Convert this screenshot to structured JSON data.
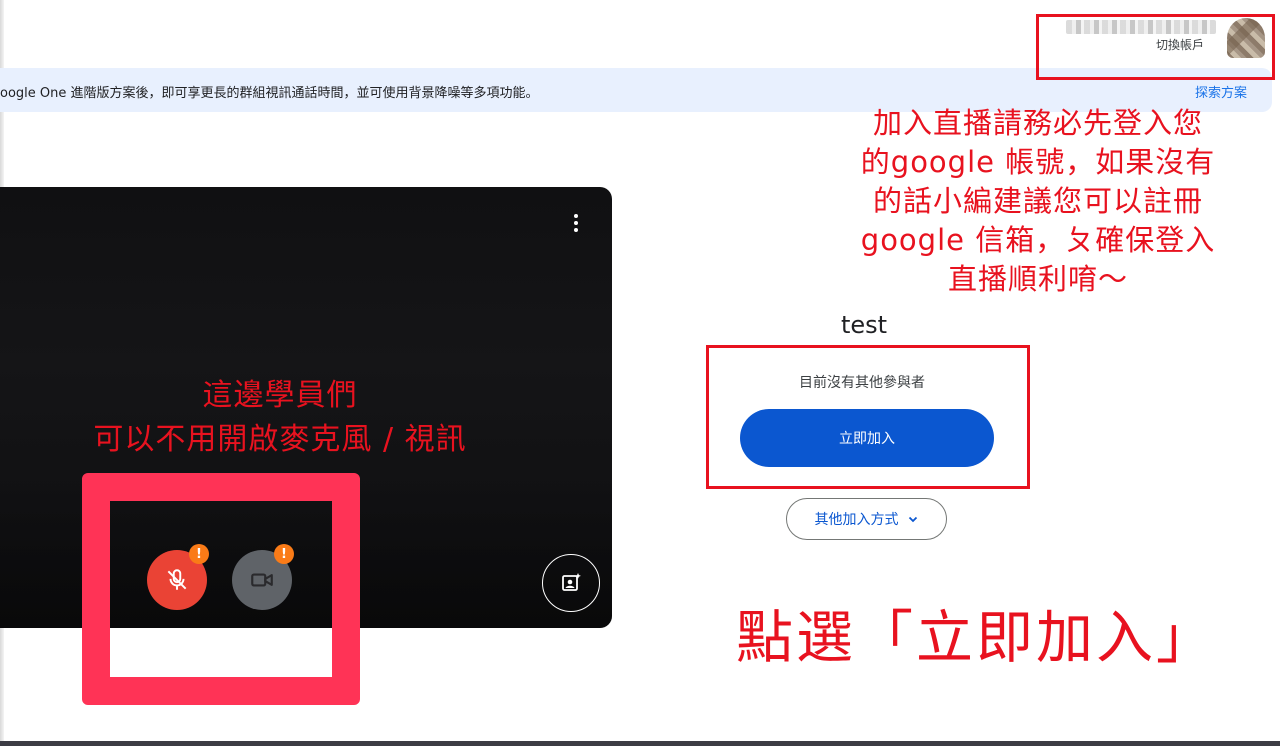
{
  "account": {
    "switch_label": "切換帳戶",
    "avatar_icon": "user-avatar-icon"
  },
  "banner": {
    "text": "oogle One 進階版方案後，即可享更長的群組視訊通話時間，並可使用背景降噪等多項功能。",
    "link_label": "探索方案"
  },
  "video": {
    "more_icon": "more-vert-icon",
    "mic_icon": "mic-off-icon",
    "camera_icon": "videocam-icon",
    "warning_badge": "!",
    "effects_icon": "visual-effects-icon"
  },
  "join_panel": {
    "title": "test",
    "status": "目前沒有其他參與者",
    "join_label": "立即加入",
    "other_ways_label": "其他加入方式",
    "other_ways_icon": "chevron-down-icon"
  },
  "annotations": {
    "login_note_lines": [
      "加入直播請務必先登入您",
      "的google 帳號，如果沒有",
      "的話小編建議您可以註冊",
      "google 信箱，ㄆ確保登入",
      "直播順利唷～"
    ],
    "students_note_lines": [
      "這邊學員們",
      "可以不用開啟麥克風 / 視訊"
    ],
    "click_note": "點選「立即加入」"
  },
  "colors": {
    "annotation_red": "#e8121f",
    "frame_pink": "#ff3356",
    "join_blue": "#0b57d0",
    "mic_red": "#ea4335",
    "banner_bg": "#e8f0fe"
  }
}
